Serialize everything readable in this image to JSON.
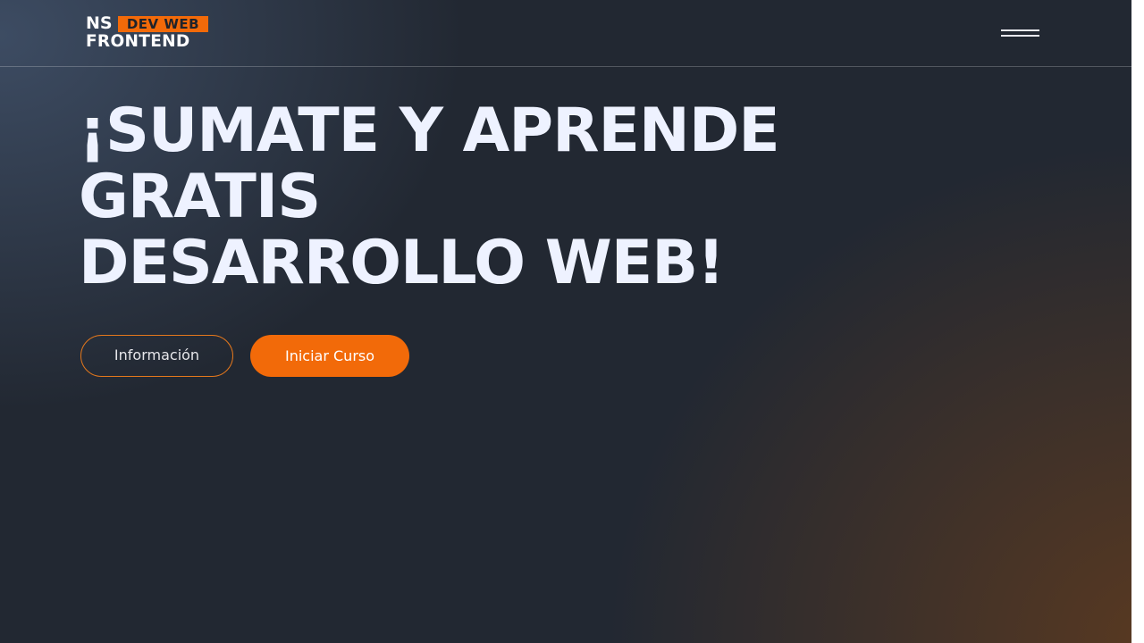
{
  "logo": {
    "line1": "NS",
    "badge": "DEV WEB",
    "line2": "FRONTEND"
  },
  "hero": {
    "title_line1": "¡SUMATE Y APRENDE",
    "title_line2": "GRATIS",
    "title_line3": "DESARROLLO WEB!"
  },
  "buttons": {
    "info_label": "Información",
    "start_label": "Iniciar Curso"
  },
  "colors": {
    "accent": "#f26a09",
    "background": "#222832",
    "title": "#eef2ff"
  },
  "icons": {
    "menu": "hamburger-menu-icon"
  }
}
